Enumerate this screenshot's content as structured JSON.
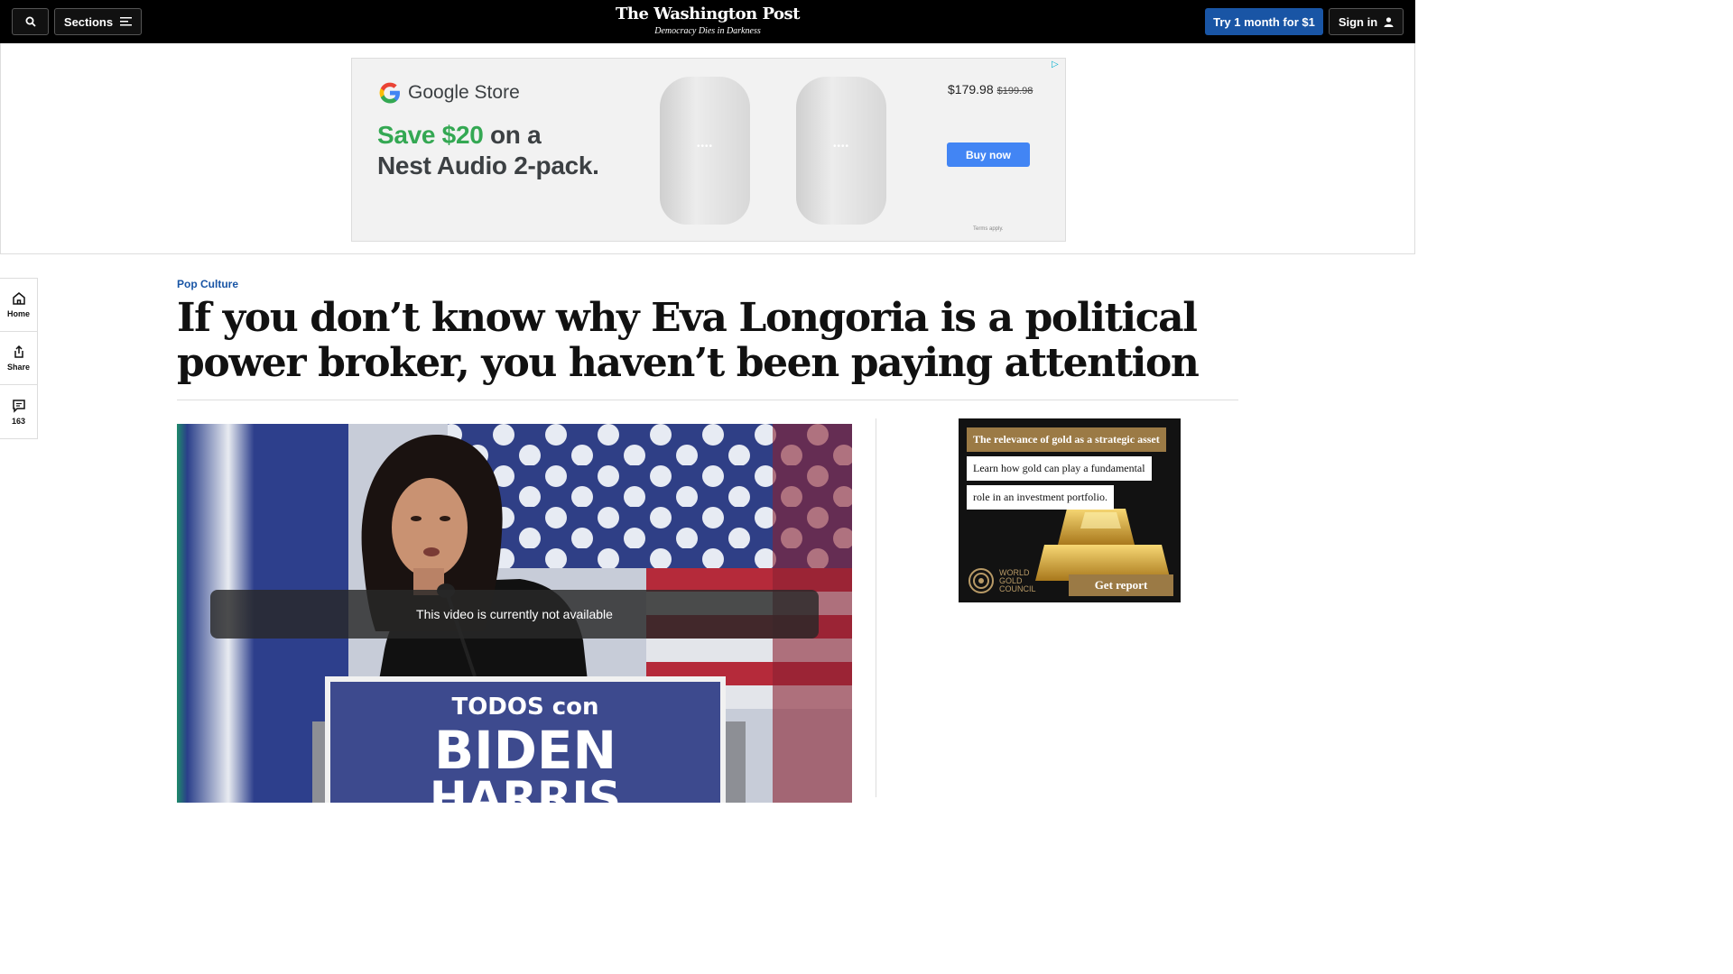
{
  "header": {
    "sections_label": "Sections",
    "logo": "The Washington Post",
    "tagline": "Democracy Dies in Darkness",
    "subscribe_label": "Try 1 month for $1",
    "signin_label": "Sign in"
  },
  "top_ad": {
    "brand": "Google Store",
    "headline_highlight": "Save $20",
    "headline_rest_1": " on a",
    "headline_rest_2": "Nest Audio 2-pack.",
    "price": "$179.98",
    "old_price": "$199.98",
    "cta": "Buy now",
    "terms": "Terms apply."
  },
  "left_rail": {
    "home": "Home",
    "share": "Share",
    "comments": "163"
  },
  "article": {
    "kicker": "Pop Culture",
    "headline": "If you don’t know why Eva Longoria is a political power broker, you haven’t been paying attention",
    "video_notice": "This video is currently not available",
    "podium_line1": "TODOS con",
    "podium_line2": "BIDEN",
    "podium_line3": "HARRIS"
  },
  "side_ad": {
    "title": "The relevance of gold as a strategic asset",
    "line1": "Learn how gold can play a fundamental",
    "line2": "role in an investment portfolio.",
    "brand": [
      "WORLD",
      "GOLD",
      "COUNCIL"
    ],
    "cta": "Get report"
  },
  "colors": {
    "accent_blue": "#1955a5",
    "google_blue": "#4285f4",
    "google_green": "#34a853",
    "gold": "#9b7a45"
  }
}
